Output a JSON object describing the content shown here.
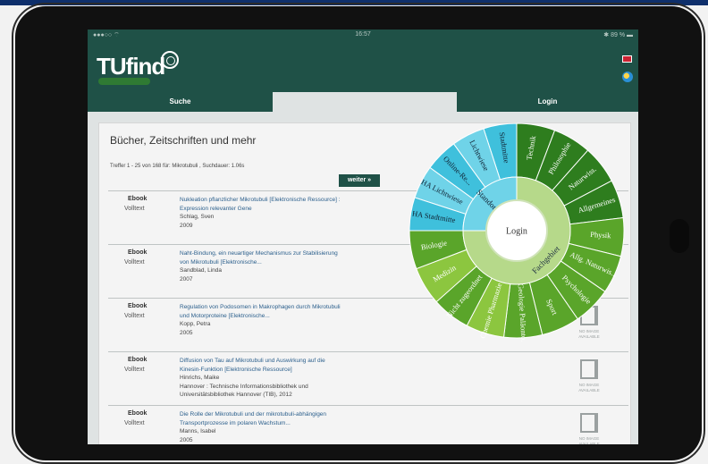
{
  "status": {
    "left": "●●●○○ ⌔",
    "time": "16:57",
    "right": "✱ 89 % ▬"
  },
  "brand": {
    "logo_text": "TUfind"
  },
  "nav": {
    "suche": "Suche",
    "login": "Login"
  },
  "page": {
    "title": "Bücher, Zeitschriften und mehr",
    "hits": "Treffer 1 - 25 von 168 für: Mikrotubuli , Suchdauer: 1.06s",
    "weiter": "weiter »"
  },
  "results": [
    {
      "type": "Ebook",
      "avail": "Volltext",
      "title": "Nukleation pflanzlicher Mikrotubuli [Elektronische Ressource] : Expression relevanter Gene",
      "author": "Schlag, Sven",
      "year": "2009"
    },
    {
      "type": "Ebook",
      "avail": "Volltext",
      "title": "Naht-Bindung, ein neuartiger Mechanismus zur Stabilisierung von Mikrotubuli [Elektronische...",
      "author": "Sandblad, Linda",
      "year": "2007"
    },
    {
      "type": "Ebook",
      "avail": "Volltext",
      "title": "Regulation von Podosomen in Makrophagen durch Mikrotubuli und Motorproteine [Elektronische...",
      "author": "Kopp, Petra",
      "year": "2005",
      "noimg": "NO IMAGE AVAILABLE"
    },
    {
      "type": "Ebook",
      "avail": "Volltext",
      "title": "Diffusion von Tau auf Mikrotubuli und Auswirkung auf die Kinesin-Funktion [Elektronische Ressource]",
      "author": "Hinrichs, Maike",
      "year": "Hannover : Technische Informationsbibliothek und Universitätsbibliothek Hannover (TIB), 2012",
      "noimg": "NO IMAGE AVAILABLE"
    },
    {
      "type": "Ebook",
      "avail": "Volltext",
      "title": "Die Rolle der Mikrotubuli und der mikrotubuli-abhängigen Transportprozesse im polaren Wachstum...",
      "author": "Manns, Isabel",
      "year": "2005",
      "noimg": "NO IMAGE AVAILABLE"
    }
  ],
  "wheel": {
    "center": "Login",
    "inner_left": "Standort",
    "inner_right": "Fachgebiet",
    "standort": [
      "Stadtmitte",
      "Lichtwiese",
      "Online-Re...",
      "HA Lichtwiese",
      "HA Stadtmitte"
    ],
    "fachgebiet": [
      "Technik",
      "Philosophie",
      "Naturwiss.",
      "Allgemeines",
      "Physik",
      "Allg. Naturwis...",
      "Psychologie",
      "Sport",
      "Geologie Paläonto...",
      "Chemie Pharmazie",
      "Nicht zugeordnet",
      "Medizin",
      "Biologie"
    ],
    "colors": {
      "cyan": "#3fc0dc",
      "cyan_light": "#6fd3e8",
      "green_dark": "#2e7d1e",
      "green": "#5aa52a",
      "green_light": "#8cc63f",
      "ring": "#b6d98a"
    }
  }
}
